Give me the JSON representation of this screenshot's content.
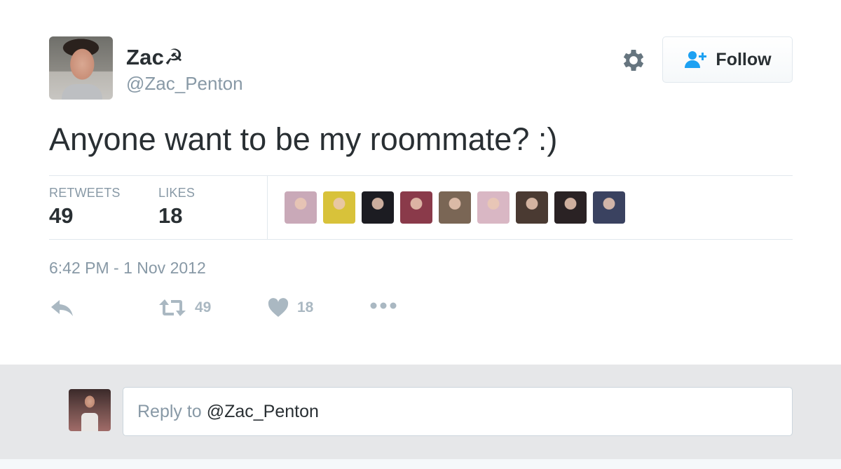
{
  "user": {
    "display_name": "Zac☭",
    "handle": "@Zac_Penton"
  },
  "header": {
    "follow_label": "Follow",
    "settings_icon": "gear-icon",
    "follow_icon": "add-user-icon"
  },
  "tweet": {
    "text": "Anyone want to be my roommate? :)",
    "timestamp": "6:42 PM - 1 Nov 2012"
  },
  "stats": {
    "retweets_label": "RETWEETS",
    "retweets_count": "49",
    "likes_label": "LIKES",
    "likes_count": "18",
    "liker_avatars": [
      "#c9a9b8",
      "#d8c23a",
      "#1c1c22",
      "#8a3a4a",
      "#7a6655",
      "#d9b7c4",
      "#4a3a32",
      "#2a2224",
      "#3a4260"
    ]
  },
  "actions": {
    "reply_icon": "reply-icon",
    "retweet_icon": "retweet-icon",
    "retweet_count": "49",
    "like_icon": "heart-icon",
    "like_count": "18",
    "more_icon": "more-icon"
  },
  "reply": {
    "prefix": "Reply to",
    "mention": "@Zac_Penton"
  },
  "colors": {
    "text": "#292f33",
    "muted": "#8899a6",
    "icon": "#aab8c2",
    "twitter_blue": "#1da1f2",
    "border": "#e1e8ed"
  }
}
